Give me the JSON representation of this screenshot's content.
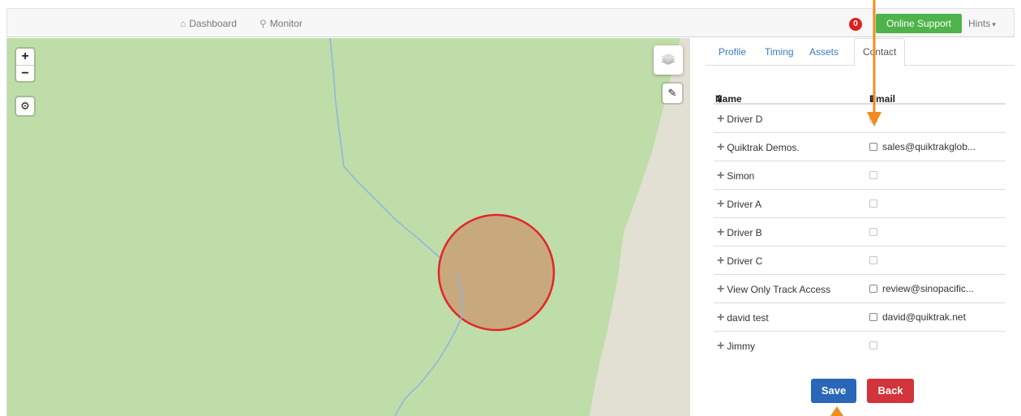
{
  "nav": {
    "dashboard": "Dashboard",
    "monitor": "Monitor",
    "dashboard_icon": "home-icon",
    "monitor_icon": "map-pin-icon"
  },
  "notifications": {
    "count": "0"
  },
  "support": {
    "label": "Online Support"
  },
  "hints": {
    "label": "Hints"
  },
  "map": {
    "zoom_in": "+",
    "zoom_out": "−"
  },
  "tabs": [
    {
      "label": "Profile"
    },
    {
      "label": "Timing"
    },
    {
      "label": "Assets"
    },
    {
      "label": "Contact"
    }
  ],
  "contacts": {
    "columns": {
      "name": "Name",
      "email": "Email"
    },
    "rows": [
      {
        "name": "Driver D",
        "email": ""
      },
      {
        "name": "Quiktrak Demos.",
        "email": "sales@quiktrakglob..."
      },
      {
        "name": "Simon",
        "email": ""
      },
      {
        "name": "Driver A",
        "email": ""
      },
      {
        "name": "Driver B",
        "email": ""
      },
      {
        "name": "Driver C",
        "email": ""
      },
      {
        "name": "View Only Track Access",
        "email": "review@sinopacific..."
      },
      {
        "name": "david test",
        "email": "david@quiktrak.net"
      },
      {
        "name": "Jimmy",
        "email": ""
      }
    ]
  },
  "actions": {
    "save": "Save",
    "back": "Back"
  },
  "colors": {
    "accent": "#2a67b8",
    "danger": "#d1343a",
    "success": "#4eb34a",
    "annotation": "#f28c1e",
    "geofence_fill": "#c8a97e",
    "geofence_stroke": "#e3242b"
  }
}
